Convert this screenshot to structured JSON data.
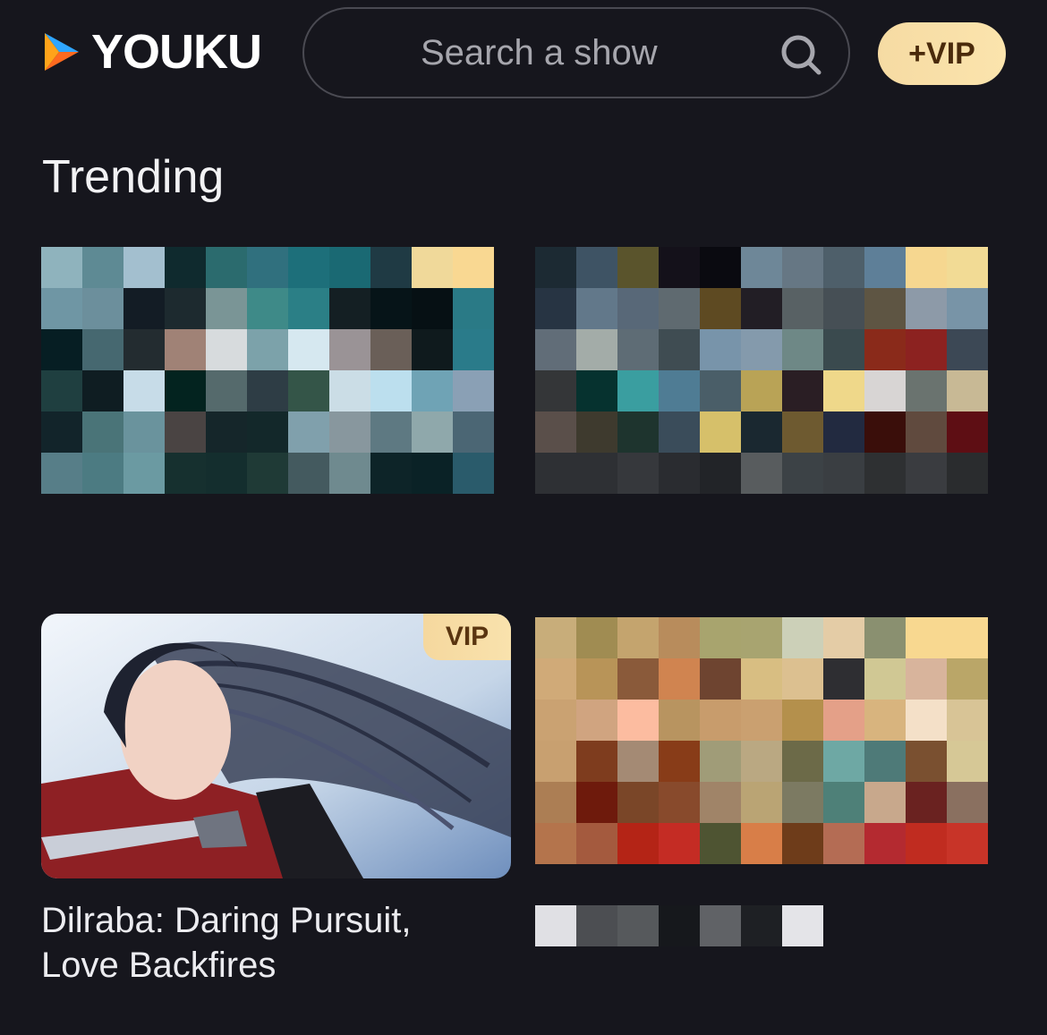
{
  "header": {
    "logo_text": "YOUKU",
    "search_placeholder": "Search a show",
    "vip_button": "+VIP"
  },
  "section": {
    "title": "Trending"
  },
  "cards": [
    {
      "badge": "VIP",
      "title_line1": "Dilraba: Daring Pursuit,",
      "title_line2": "Love Backfires"
    }
  ],
  "colors": {
    "background": "#16161d",
    "vip_gold": "#f8dfa8",
    "logo_orange": "#ff6a1f",
    "logo_blue": "#2fa6ff"
  },
  "icons": [
    "youku-logo-icon",
    "search-icon"
  ]
}
